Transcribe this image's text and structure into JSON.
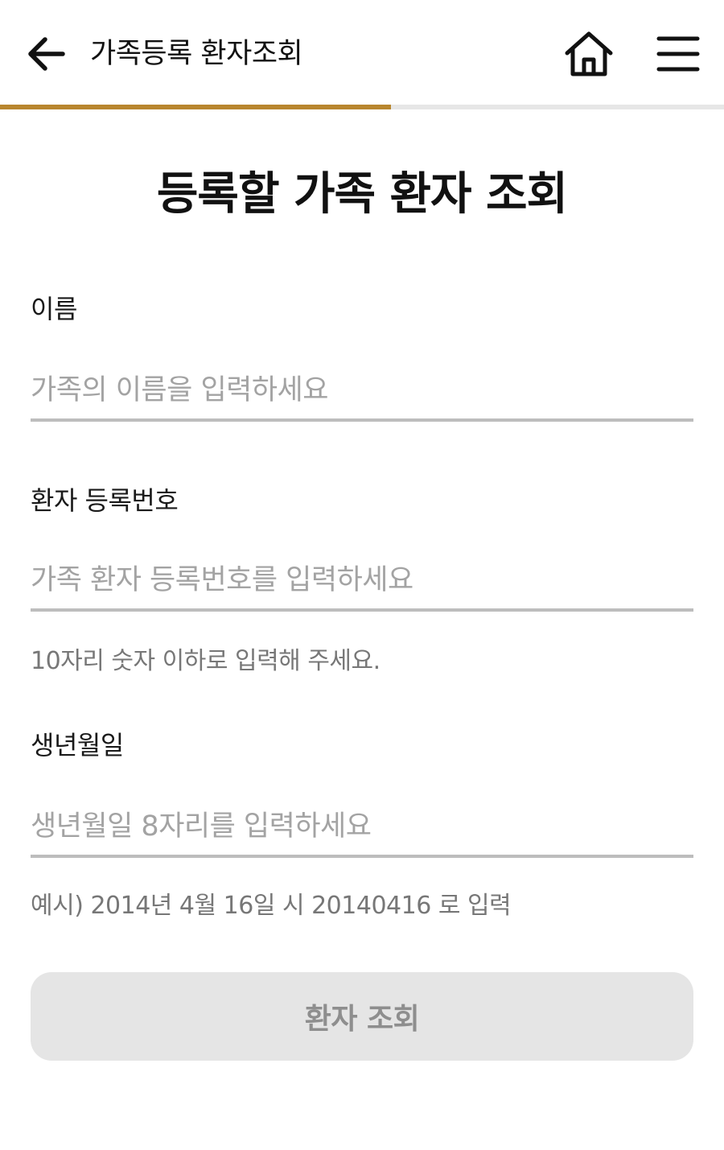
{
  "header": {
    "title": "가족등록 환자조회",
    "back_icon": "arrow-left-icon",
    "home_icon": "home-icon",
    "menu_icon": "hamburger-menu-icon"
  },
  "progress": {
    "fraction": 0.54,
    "fill_color": "#b8862e",
    "track_color": "#e6e6e6"
  },
  "page": {
    "title": "등록할 가족 환자 조회"
  },
  "form": {
    "name": {
      "label": "이름",
      "placeholder": "가족의 이름을 입력하세요",
      "value": ""
    },
    "patient_number": {
      "label": "환자 등록번호",
      "placeholder": "가족 환자 등록번호를 입력하세요",
      "value": "",
      "helper": "10자리 숫자 이하로 입력해 주세요."
    },
    "birthdate": {
      "label": "생년월일",
      "placeholder": "생년월일 8자리를 입력하세요",
      "value": "",
      "helper": "예시) 2014년 4월 16일 시 20140416 로 입력"
    }
  },
  "submit": {
    "label": "환자 조회"
  }
}
